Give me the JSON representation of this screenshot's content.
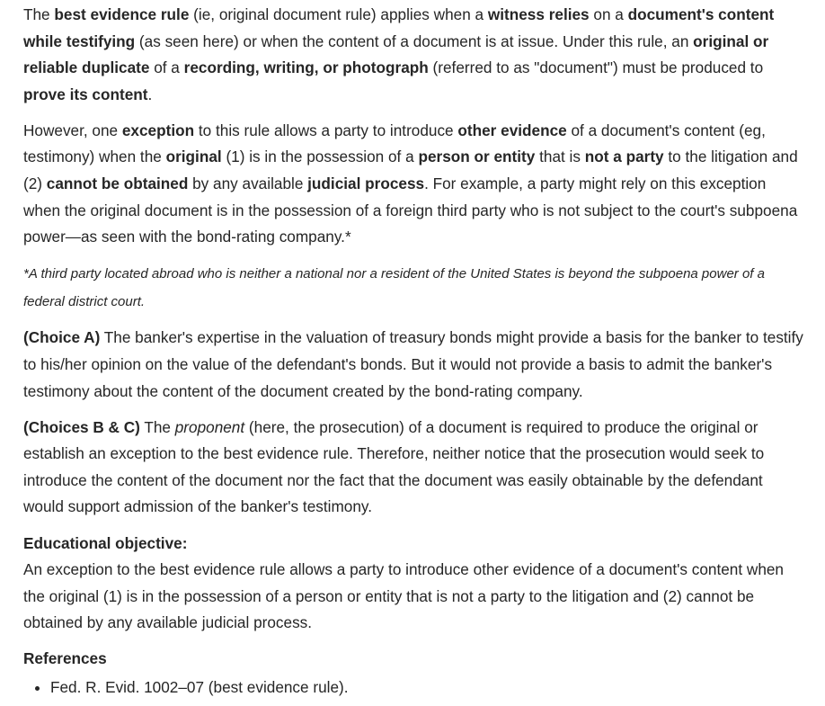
{
  "paragraphs": [
    {
      "name": "best-evidence-rule-paragraph",
      "cls": "gap",
      "segments": [
        {
          "text": "The "
        },
        {
          "text": "best evidence rule",
          "bold": true
        },
        {
          "text": " (ie, original document rule) applies when a "
        },
        {
          "text": "witness relies",
          "bold": true
        },
        {
          "text": " on a "
        },
        {
          "text": "document's content while testifying",
          "bold": true
        },
        {
          "text": " (as seen here) or when the content of a document is at issue.  Under this rule, an "
        },
        {
          "text": "original or reliable duplicate",
          "bold": true
        },
        {
          "text": " of a "
        },
        {
          "text": "recording, writing, or photograph",
          "bold": true
        },
        {
          "text": " (referred to as \"document\") must be produced to "
        },
        {
          "text": "prove its content",
          "bold": true
        },
        {
          "text": "."
        }
      ]
    },
    {
      "name": "exception-paragraph",
      "cls": "gap",
      "segments": [
        {
          "text": "However, one "
        },
        {
          "text": "exception",
          "bold": true
        },
        {
          "text": " to this rule allows a party to introduce "
        },
        {
          "text": "other evidence",
          "bold": true
        },
        {
          "text": " of a document's content (eg, testimony) when the "
        },
        {
          "text": "original",
          "bold": true
        },
        {
          "text": " (1) is in the possession of a "
        },
        {
          "text": "person or entity",
          "bold": true
        },
        {
          "text": " that is "
        },
        {
          "text": "not a party",
          "bold": true
        },
        {
          "text": " to the litigation and (2) "
        },
        {
          "text": "cannot be obtained",
          "bold": true
        },
        {
          "text": " by any available "
        },
        {
          "text": "judicial process",
          "bold": true
        },
        {
          "text": ".  For example, a party might rely on this exception when the original document is in the possession of a foreign third party who is not subject to the court's subpoena power—as seen with the bond-rating company.*"
        }
      ]
    },
    {
      "name": "footnote-paragraph",
      "cls": "foot",
      "segments": [
        {
          "text": "*A third party located abroad who is neither a national nor a resident of the United States is beyond the subpoena power of a federal district court."
        }
      ]
    },
    {
      "name": "choice-a-paragraph",
      "cls": "gap",
      "segments": [
        {
          "text": "(Choice A)",
          "bold": true
        },
        {
          "text": "  The banker's expertise in the valuation of treasury bonds might provide a basis for the banker to testify to his/her opinion on the value of the defendant's bonds.  But it would not provide a basis to admit the banker's testimony about the content of the document created by the bond-rating company."
        }
      ]
    },
    {
      "name": "choices-b-c-paragraph",
      "cls": "gap",
      "segments": [
        {
          "text": "(Choices B & C)",
          "bold": true
        },
        {
          "text": "  The "
        },
        {
          "text": "proponent",
          "italic": true
        },
        {
          "text": " (here, the prosecution) of a document is required to produce the original or establish an exception to the best evidence rule.  Therefore, neither notice that the prosecution would seek to introduce the content of the document nor the fact that the document was easily obtainable by the defendant would support admission of the banker's testimony."
        }
      ]
    }
  ],
  "objective": {
    "heading": "Educational objective:",
    "text": "An exception to the best evidence rule allows a party to introduce other evidence of a document's content when the original (1) is in the possession of a person or entity that is not a party to the litigation and (2) cannot be obtained by any available judicial process."
  },
  "references": {
    "heading": "References",
    "items": [
      "Fed. R. Evid. 1002–07 (best evidence rule)."
    ]
  }
}
